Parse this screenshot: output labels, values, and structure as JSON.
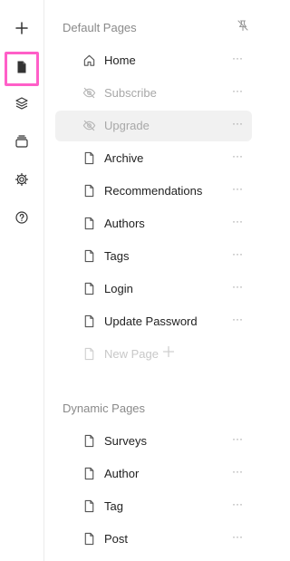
{
  "rail": {
    "items": [
      {
        "name": "add-button",
        "icon": "plus-icon"
      },
      {
        "name": "pages-button",
        "icon": "page-icon"
      },
      {
        "name": "layers-button",
        "icon": "layers-icon"
      },
      {
        "name": "archive-button",
        "icon": "tray-icon"
      },
      {
        "name": "settings-button",
        "icon": "gear-icon"
      },
      {
        "name": "help-button",
        "icon": "help-icon"
      }
    ],
    "active_color": "#ff5fc8"
  },
  "default_pages": {
    "title": "Default Pages",
    "items": [
      {
        "label": "Home",
        "icon": "home-icon",
        "state": "normal"
      },
      {
        "label": "Subscribe",
        "icon": "eye-off-icon",
        "state": "hidden"
      },
      {
        "label": "Upgrade",
        "icon": "eye-off-icon",
        "state": "hidden-hover"
      },
      {
        "label": "Archive",
        "icon": "page-icon",
        "state": "normal"
      },
      {
        "label": "Recommendations",
        "icon": "page-icon",
        "state": "normal"
      },
      {
        "label": "Authors",
        "icon": "page-icon",
        "state": "normal"
      },
      {
        "label": "Tags",
        "icon": "page-icon",
        "state": "normal"
      },
      {
        "label": "Login",
        "icon": "page-icon",
        "state": "normal"
      },
      {
        "label": "Update Password",
        "icon": "page-icon",
        "state": "normal"
      }
    ],
    "new_page_label": "New Page"
  },
  "dynamic_pages": {
    "title": "Dynamic Pages",
    "items": [
      {
        "label": "Surveys",
        "icon": "page-icon"
      },
      {
        "label": "Author",
        "icon": "page-icon"
      },
      {
        "label": "Tag",
        "icon": "page-icon"
      },
      {
        "label": "Post",
        "icon": "page-icon"
      }
    ]
  },
  "more_glyph": "···"
}
